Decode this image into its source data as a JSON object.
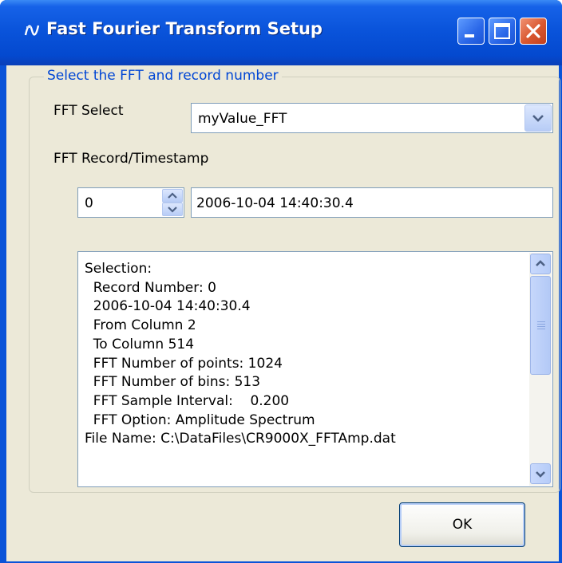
{
  "window": {
    "title": "Fast Fourier Transform Setup",
    "title_bar_color": "#0a54db",
    "close_button_color": "#d9572f"
  },
  "group": {
    "legend": "Select the FFT and record number",
    "legend_color": "#0046d5"
  },
  "fft_select": {
    "label": "FFT Select",
    "value": "myValue_FFT"
  },
  "record": {
    "label": "FFT Record/Timestamp",
    "number": "0",
    "timestamp": "2006-10-04 14:40:30.4"
  },
  "selection_info": {
    "lines": [
      "Selection:",
      "  Record Number: 0",
      "  2006-10-04 14:40:30.4",
      "  From Column 2",
      "  To Column 514",
      "  FFT Number of points: 1024",
      "  FFT Number of bins: 513",
      "  FFT Sample Interval:    0.200",
      "  FFT Option: Amplitude Spectrum",
      "File Name: C:\\DataFiles\\CR9000X_FFTAmp.dat"
    ]
  },
  "buttons": {
    "ok": "OK"
  },
  "icons": {
    "app": "waveform-app-icon",
    "minimize": "minimize-icon",
    "maximize": "maximize-icon",
    "close": "close-icon"
  }
}
